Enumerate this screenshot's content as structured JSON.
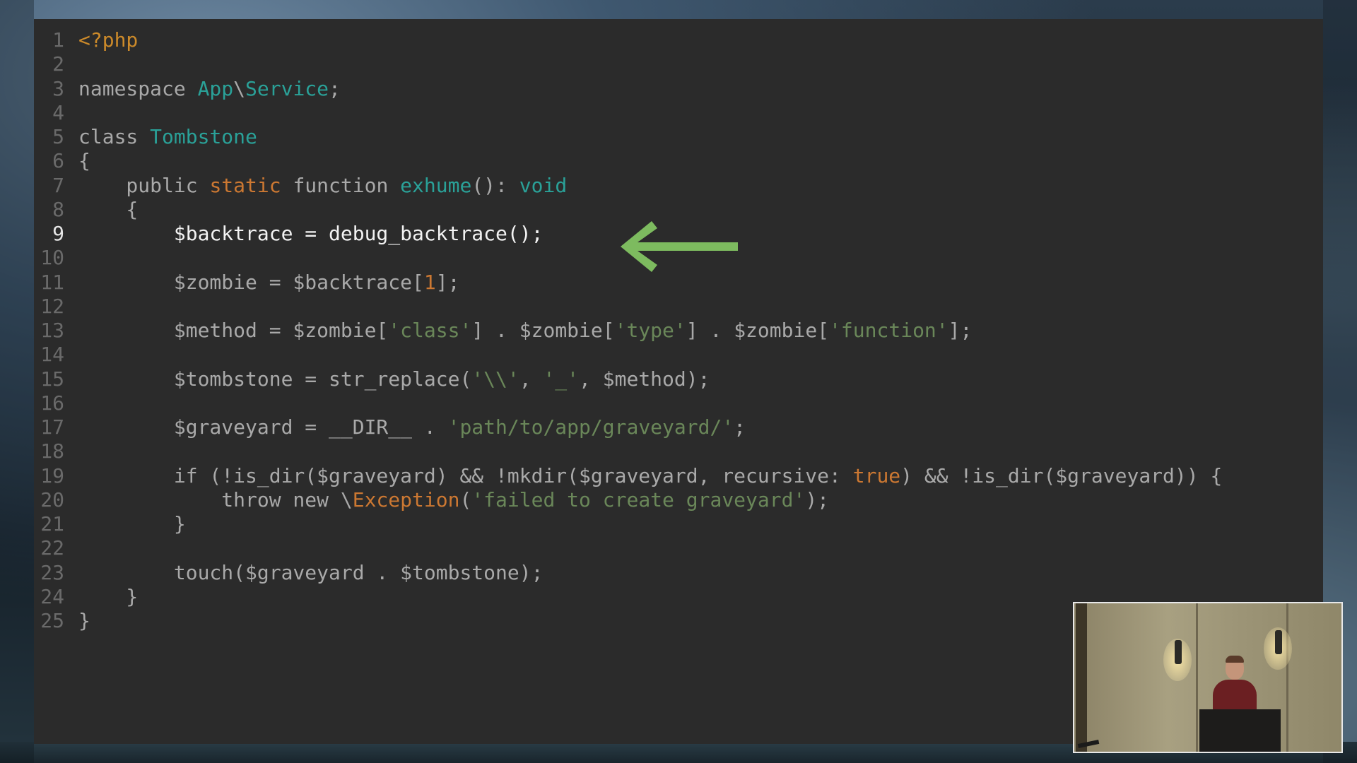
{
  "editor": {
    "active_line": 9,
    "lines": [
      {
        "n": "1",
        "tokens": [
          {
            "t": "<?php",
            "c": "php"
          }
        ]
      },
      {
        "n": "2",
        "tokens": []
      },
      {
        "n": "3",
        "tokens": [
          {
            "t": "namespace "
          },
          {
            "t": "App",
            "c": "cls"
          },
          {
            "t": "\\"
          },
          {
            "t": "Service",
            "c": "cls"
          },
          {
            "t": ";"
          }
        ]
      },
      {
        "n": "4",
        "tokens": []
      },
      {
        "n": "5",
        "tokens": [
          {
            "t": "class "
          },
          {
            "t": "Tombstone",
            "c": "cls"
          }
        ]
      },
      {
        "n": "6",
        "tokens": [
          {
            "t": "{"
          }
        ]
      },
      {
        "n": "7",
        "tokens": [
          {
            "t": "    public "
          },
          {
            "t": "static",
            "c": "kw-or"
          },
          {
            "t": " function "
          },
          {
            "t": "exhume",
            "c": "cls"
          },
          {
            "t": "(): "
          },
          {
            "t": "void",
            "c": "cls"
          }
        ]
      },
      {
        "n": "8",
        "tokens": [
          {
            "t": "    {"
          }
        ]
      },
      {
        "n": "9",
        "tokens": [
          {
            "t": "        $backtrace = debug_backtrace();"
          }
        ]
      },
      {
        "n": "10",
        "tokens": []
      },
      {
        "n": "11",
        "tokens": [
          {
            "t": "        $zombie = $backtrace["
          },
          {
            "t": "1",
            "c": "num"
          },
          {
            "t": "];"
          }
        ]
      },
      {
        "n": "12",
        "tokens": []
      },
      {
        "n": "13",
        "tokens": [
          {
            "t": "        $method = $zombie["
          },
          {
            "t": "'class'",
            "c": "str"
          },
          {
            "t": "] . $zombie["
          },
          {
            "t": "'type'",
            "c": "str"
          },
          {
            "t": "] . $zombie["
          },
          {
            "t": "'function'",
            "c": "str"
          },
          {
            "t": "];"
          }
        ]
      },
      {
        "n": "14",
        "tokens": []
      },
      {
        "n": "15",
        "tokens": [
          {
            "t": "        $tombstone = str_replace("
          },
          {
            "t": "'\\\\'",
            "c": "str"
          },
          {
            "t": ", "
          },
          {
            "t": "'_'",
            "c": "str"
          },
          {
            "t": ", $method);"
          }
        ]
      },
      {
        "n": "16",
        "tokens": []
      },
      {
        "n": "17",
        "tokens": [
          {
            "t": "        $graveyard = __DIR__ . "
          },
          {
            "t": "'path/to/app/graveyard/'",
            "c": "str"
          },
          {
            "t": ";"
          }
        ]
      },
      {
        "n": "18",
        "tokens": []
      },
      {
        "n": "19",
        "tokens": [
          {
            "t": "        if (!is_dir($graveyard) && !mkdir($graveyard, recursive: "
          },
          {
            "t": "true",
            "c": "kw-or"
          },
          {
            "t": ") && !is_dir($graveyard)) {"
          }
        ]
      },
      {
        "n": "20",
        "tokens": [
          {
            "t": "            throw new \\"
          },
          {
            "t": "Exception",
            "c": "kw-or"
          },
          {
            "t": "("
          },
          {
            "t": "'failed to create graveyard'",
            "c": "str"
          },
          {
            "t": ");"
          }
        ]
      },
      {
        "n": "21",
        "tokens": [
          {
            "t": "        }"
          }
        ]
      },
      {
        "n": "22",
        "tokens": []
      },
      {
        "n": "23",
        "tokens": [
          {
            "t": "        touch($graveyard . $tombstone);"
          }
        ]
      },
      {
        "n": "24",
        "tokens": [
          {
            "t": "    }"
          }
        ]
      },
      {
        "n": "25",
        "tokens": [
          {
            "t": "}"
          }
        ]
      }
    ]
  },
  "annotation": {
    "arrow_color": "#7dbb5f",
    "icon": "left-arrow-icon"
  },
  "colors": {
    "editor_bg": "#2b2b2b",
    "text": "#a9a9a9",
    "class": "#2aa198",
    "string": "#6a8759",
    "keyword": "#cc7832"
  },
  "webcam": {
    "icon": "speaker-video-feed"
  }
}
